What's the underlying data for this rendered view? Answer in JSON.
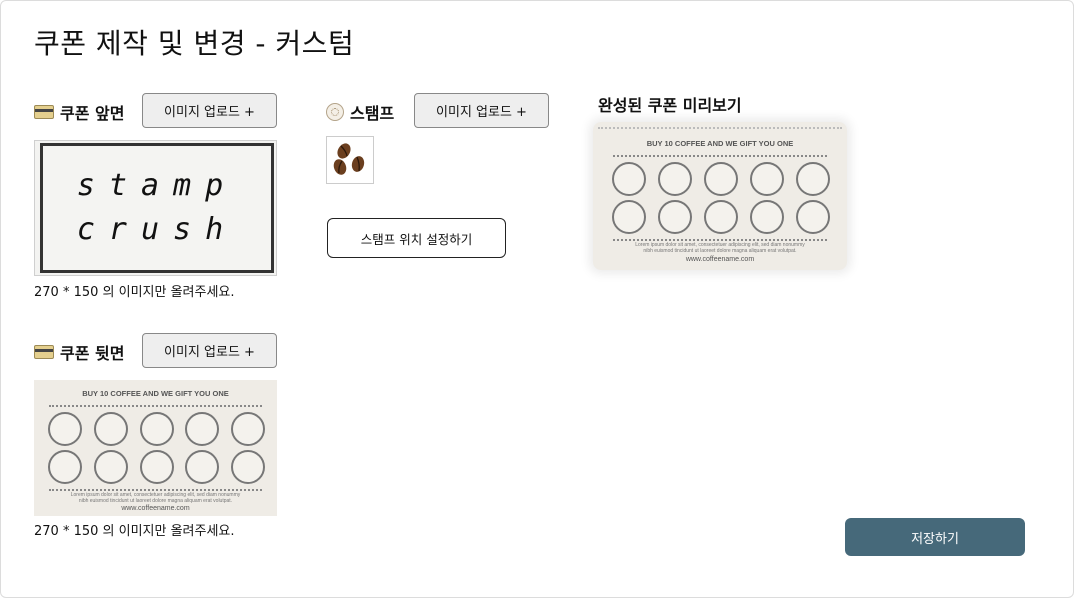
{
  "page": {
    "title": "쿠폰 제작 및 변경 - 커스텀"
  },
  "front": {
    "label": "쿠폰 앞면",
    "upload_label": "이미지 업로드 +",
    "image_text_line1": "stamp",
    "image_text_line2": "crush",
    "hint": "270 * 150 의 이미지만 올려주세요."
  },
  "back": {
    "label": "쿠폰 뒷면",
    "upload_label": "이미지 업로드 +",
    "hint": "270 * 150 의 이미지만 올려주세요."
  },
  "stamp": {
    "label": "스탬프",
    "upload_label": "이미지 업로드 +",
    "position_button": "스탬프 위치 설정하기"
  },
  "preview": {
    "label": "완성된 쿠폰 미리보기"
  },
  "coffee_card": {
    "header": "BUY 10 COFFEE AND WE GIFT YOU ONE",
    "lorem_line1": "Lorem ipsum dolor sit amet, consectetuer adipiscing elit, sed diam nonummy",
    "lorem_line2": "nibh euismod tincidunt ut laoreet dolore magna aliquam erat volutpat.",
    "site": "www.coffeename.com"
  },
  "actions": {
    "save": "저장하기"
  },
  "icons": {
    "front": "card-icon",
    "back": "card-icon",
    "stamp": "stamp-icon",
    "stamp_image": "coffee-beans-icon"
  },
  "colors": {
    "save_button": "#46697a",
    "upload_button_bg": "#eeeeee"
  }
}
